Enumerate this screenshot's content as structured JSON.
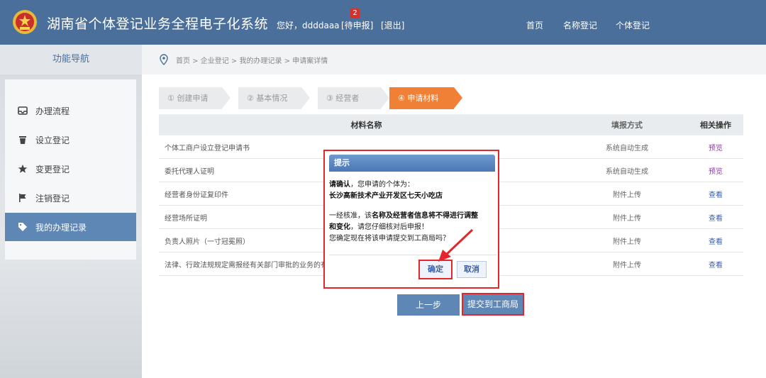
{
  "header": {
    "title": "湖南省个体登记业务全程电子化系统",
    "greeting": "您好，ddddaaa",
    "todo_label": "[待申报]",
    "todo_count": "2",
    "logout_label": "[退出]",
    "nav": [
      "首页",
      "名称登记",
      "个体登记"
    ]
  },
  "sidebar": {
    "title": "功能导航",
    "items": [
      {
        "label": "办理流程",
        "icon": "inbox-icon"
      },
      {
        "label": "设立登记",
        "icon": "trash-icon"
      },
      {
        "label": "变更登记",
        "icon": "star-icon"
      },
      {
        "label": "注销登记",
        "icon": "flag-icon"
      },
      {
        "label": "我的办理记录",
        "icon": "tag-icon",
        "active": true
      }
    ]
  },
  "breadcrumb": "首页 > 企业登记 > 我的办理记录 > 申请案详情",
  "steps": [
    "① 创建申请",
    "② 基本情况",
    "③ 经营者",
    "④ 申请材料"
  ],
  "table": {
    "headers": [
      "材料名称",
      "填报方式",
      "相关操作"
    ],
    "rows": [
      {
        "name": "个体工商户设立登记申请书",
        "mode": "系统自动生成",
        "op": "预览"
      },
      {
        "name": "委托代理人证明",
        "mode": "系统自动生成",
        "op": "预览"
      },
      {
        "name": "经营者身份证复印件",
        "mode": "附件上传",
        "op": "查看"
      },
      {
        "name": "经营场所证明",
        "mode": "附件上传",
        "op": "查看"
      },
      {
        "name": "负责人照片（一寸冠冕照）",
        "mode": "附件上传",
        "op": "查看"
      },
      {
        "name": "法律、行政法规规定需报经有关部门审批的业务的有",
        "mode": "附件上传",
        "op": "查看"
      }
    ]
  },
  "buttons": {
    "prev": "上一步",
    "submit": "提交到工商局"
  },
  "dialog": {
    "title": "提示",
    "line1_bold": "请确认",
    "line1_rest": "，您申请的个体为：",
    "business_name": "长沙高新技术产业开发区七天小吃店",
    "line3_pre": "一经核准，该",
    "line3_bold": "名称及经营者信息将不得进行调整",
    "line4_bold": "和变化",
    "line4_rest": "，请您仔细核对后申报！",
    "line5": "您确定现在将该申请提交到工商局吗？",
    "ok": "确定",
    "cancel": "取消"
  },
  "colors": {
    "header": "#4a6f9a",
    "active_step": "#ef8035",
    "highlight": "#e2262b",
    "button": "#5f87b6"
  }
}
